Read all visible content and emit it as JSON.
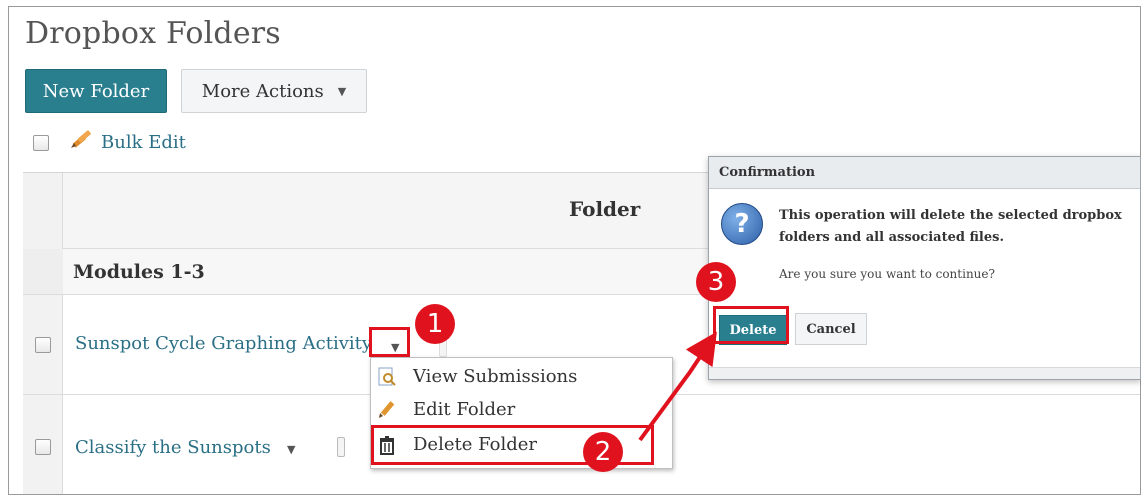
{
  "page": {
    "title": "Dropbox Folders",
    "new_folder_label": "New Folder",
    "more_actions_label": "More Actions",
    "bulk_edit_label": "Bulk Edit"
  },
  "table": {
    "column_header": "Folder",
    "group_label": "Modules 1-3",
    "rows": [
      {
        "label": "Sunspot Cycle Graphing Activity"
      },
      {
        "label": "Classify the Sunspots"
      }
    ]
  },
  "context_menu": {
    "items": [
      {
        "label": "View Submissions",
        "icon": "view-submissions-icon"
      },
      {
        "label": "Edit Folder",
        "icon": "pencil-icon"
      },
      {
        "label": "Delete Folder",
        "icon": "trash-icon"
      }
    ]
  },
  "dialog": {
    "title": "Confirmation",
    "message": "This operation will delete the selected dropbox folders and all associated files.",
    "question": "Are you sure you want to continue?",
    "delete_label": "Delete",
    "cancel_label": "Cancel"
  },
  "annotations": {
    "step1": "1",
    "step2": "2",
    "step3": "3",
    "color": "#e0121e"
  },
  "colors": {
    "primary_button": "#2a7f8f",
    "link": "#2a6f86"
  }
}
